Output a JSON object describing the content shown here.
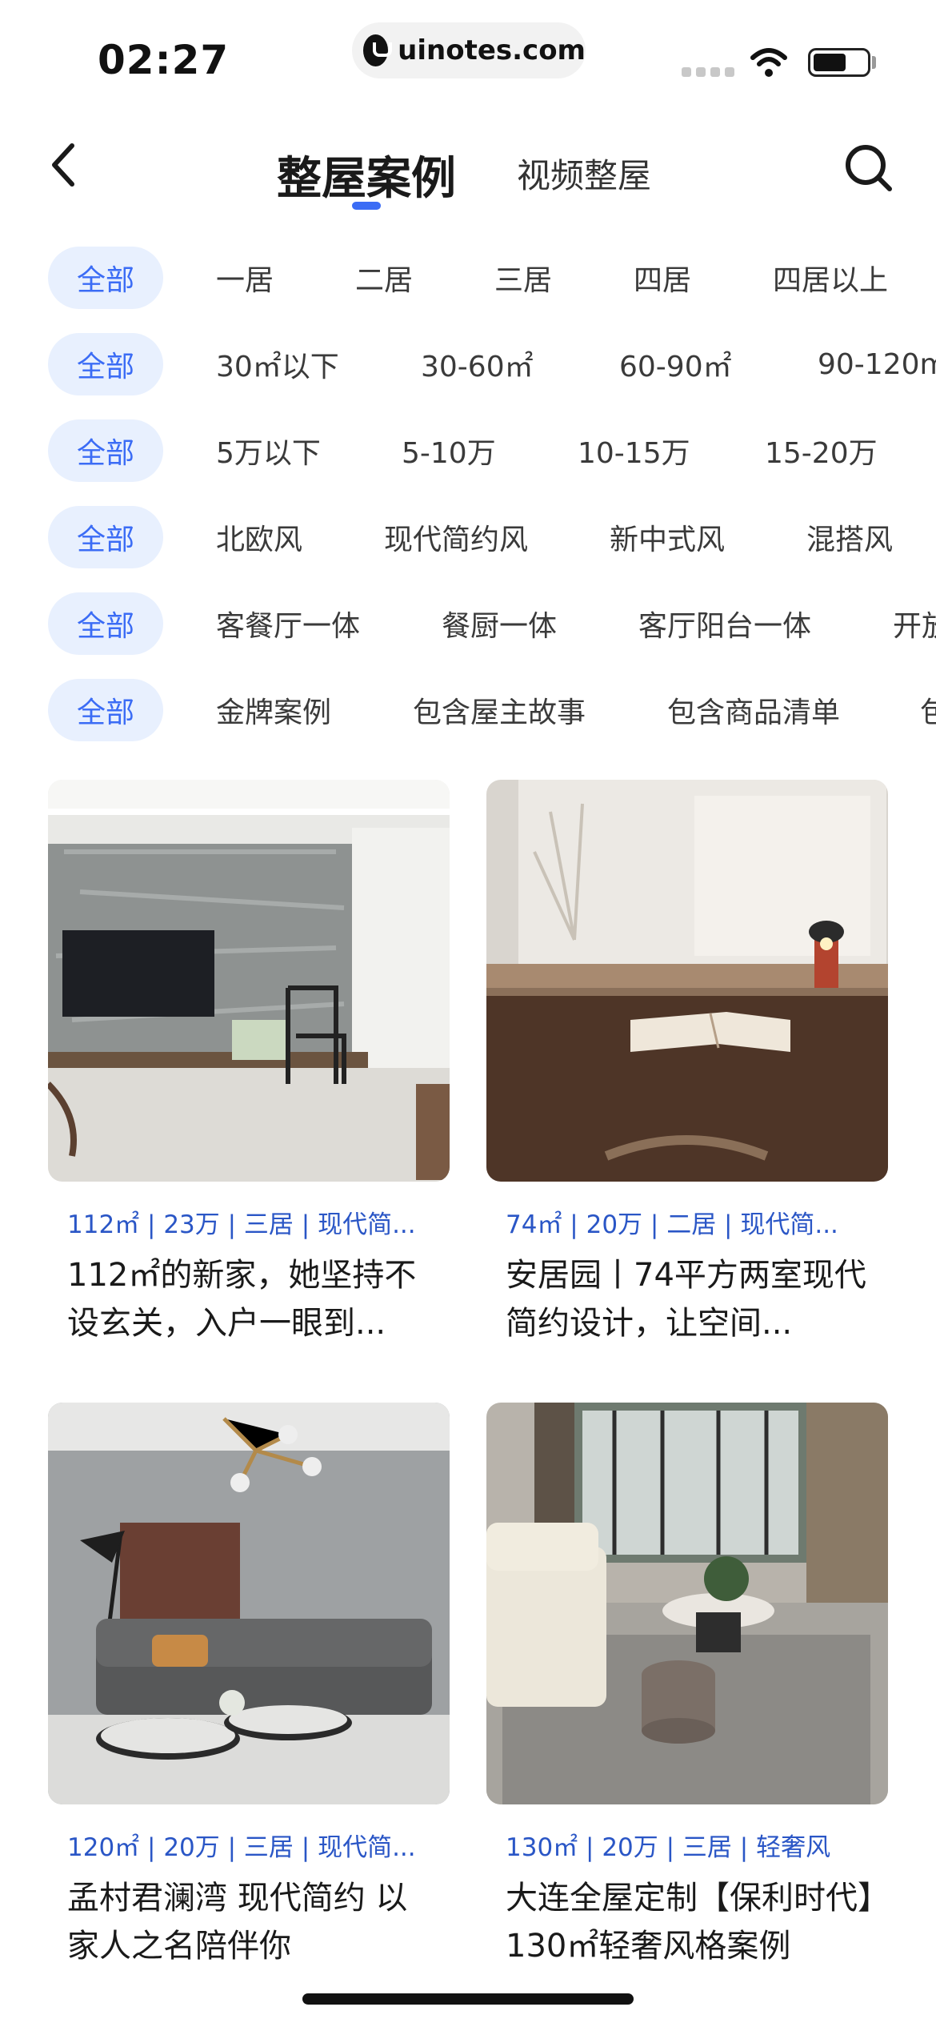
{
  "status_bar": {
    "time": "02:27",
    "url": "uinotes.com"
  },
  "header": {
    "tab_active": "整屋案例",
    "tab_other": "视频整屋",
    "accent_color": "#3b6cf5",
    "icons": [
      "back-chevron-icon",
      "search-icon"
    ]
  },
  "filters": [
    {
      "all_label": "全部",
      "options": [
        "一居",
        "二居",
        "三居",
        "四居",
        "四居以上"
      ]
    },
    {
      "all_label": "全部",
      "options": [
        "30㎡以下",
        "30-60㎡",
        "60-90㎡",
        "90-120m"
      ]
    },
    {
      "all_label": "全部",
      "options": [
        "5万以下",
        "5-10万",
        "10-15万",
        "15-20万"
      ]
    },
    {
      "all_label": "全部",
      "options": [
        "北欧风",
        "现代简约风",
        "新中式风",
        "混搭风"
      ]
    },
    {
      "all_label": "全部",
      "options": [
        "客餐厅一体",
        "餐厨一体",
        "客厅阳台一体",
        "开放"
      ]
    },
    {
      "all_label": "全部",
      "options": [
        "金牌案例",
        "包含屋主故事",
        "包含商品清单",
        "包"
      ]
    }
  ],
  "cards": [
    {
      "tags": "112㎡ | 23万 | 三居 | 现代简...",
      "title": "112㎡的新家，她坚持不设玄关，入户一眼到..."
    },
    {
      "tags": "74㎡ | 20万 | 二居 | 现代简...",
      "title": "安居园丨74平方两室现代简约设计，让空间..."
    },
    {
      "tags": "120㎡ | 20万 | 三居 | 现代简...",
      "title": "孟村君澜湾 现代简约 以家人之名陪伴你"
    },
    {
      "tags": "130㎡ | 20万 | 三居 | 轻奢风",
      "title": "大连全屋定制【保利时代】130㎡轻奢风格案例"
    }
  ]
}
